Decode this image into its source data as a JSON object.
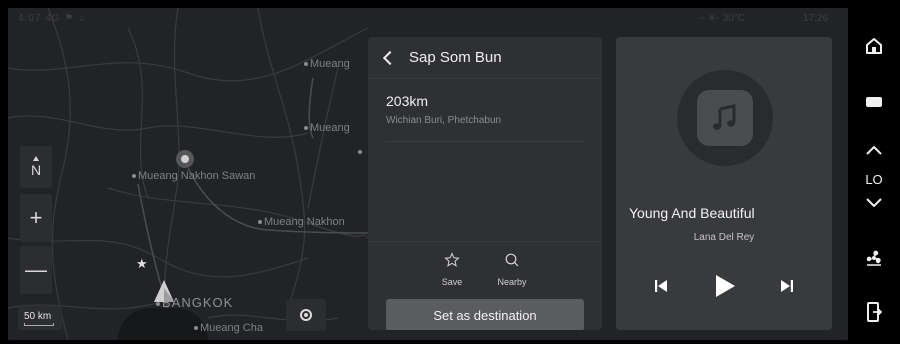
{
  "status": {
    "left_text": "4:07  4G  ⚑  ♫",
    "right_text": "◦◦  ✳◦  30°C",
    "time": "17:26"
  },
  "map": {
    "cities": [
      {
        "name": "Mueang"
      },
      {
        "name": "Mueang"
      },
      {
        "name": "Mueang Nakhon Sawan"
      },
      {
        "name": "Mueang Nakhon"
      },
      {
        "name": "BANGKOK"
      },
      {
        "name": "Mueang Cha"
      }
    ],
    "compass_label": "N",
    "zoom_in_label": "+",
    "zoom_out_label": "—",
    "scale_label": "50 km"
  },
  "place": {
    "title": "Sap Som Bun",
    "distance": "203km",
    "address": "Wichian Buri, Phetchabun",
    "save_label": "Save",
    "nearby_label": "Nearby",
    "destination_label": "Set as destination"
  },
  "media": {
    "song_title": "Young And Beautiful",
    "artist": "Lana Del Rey"
  },
  "rail": {
    "fan_level": "LO"
  },
  "colors": {
    "panel_bg": "#2f3033",
    "media_bg": "#393a3d",
    "button_bg": "#5b5c60",
    "map_bg": "#222326"
  }
}
